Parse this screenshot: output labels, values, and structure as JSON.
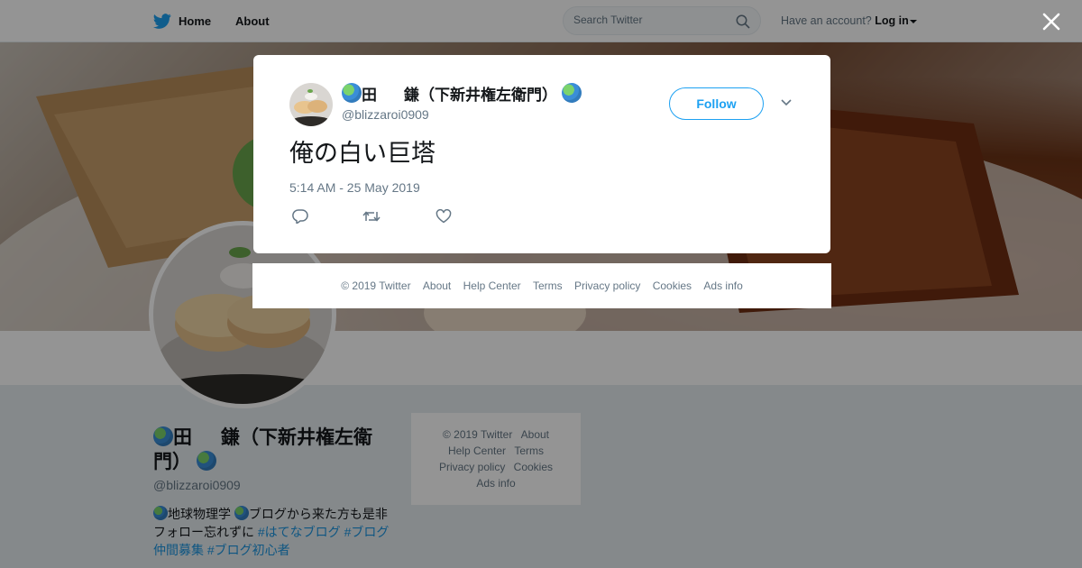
{
  "nav": {
    "home_label": "Home",
    "about_label": "About",
    "search_placeholder": "Search Twitter",
    "have_account": "Have an account?",
    "login_label": "Log in"
  },
  "profile": {
    "name_prefix": "田",
    "name_middle": "鎌（下新井権左衛門）",
    "handle": "@blizzaroi0909",
    "bio_text_1": "地球物理学",
    "bio_text_2": "ブログから来た方も是非フォロー忘れずに",
    "bio_tags": [
      "#はてなブログ",
      "#ブログ仲間募集",
      "#ブログ初心者"
    ]
  },
  "footer_side": {
    "copyright": "© 2019 Twitter",
    "links": [
      "About",
      "Help Center",
      "Terms",
      "Privacy policy",
      "Cookies",
      "Ads info"
    ]
  },
  "tweet": {
    "name_prefix": "田",
    "name_middle": "鎌（下新井権左衛門）",
    "handle": "@blizzaroi0909",
    "follow_label": "Follow",
    "text": "俺の白い巨塔",
    "timestamp": "5:14 AM - 25 May 2019"
  },
  "modal_footer": {
    "copyright": "© 2019 Twitter",
    "links": [
      "About",
      "Help Center",
      "Terms",
      "Privacy policy",
      "Cookies",
      "Ads info"
    ]
  },
  "icons": {
    "brand": "twitter-bird-icon",
    "search": "search-icon",
    "close": "close-icon",
    "reply": "reply-icon",
    "retweet": "retweet-icon",
    "like": "heart-icon",
    "more": "chevron-down-icon",
    "emoji": "globe-emoji-icon"
  },
  "colors": {
    "brand_blue": "#1da1f2",
    "link_blue": "#1b95e0",
    "muted_gray": "#657786",
    "text_dark": "#14171a"
  }
}
